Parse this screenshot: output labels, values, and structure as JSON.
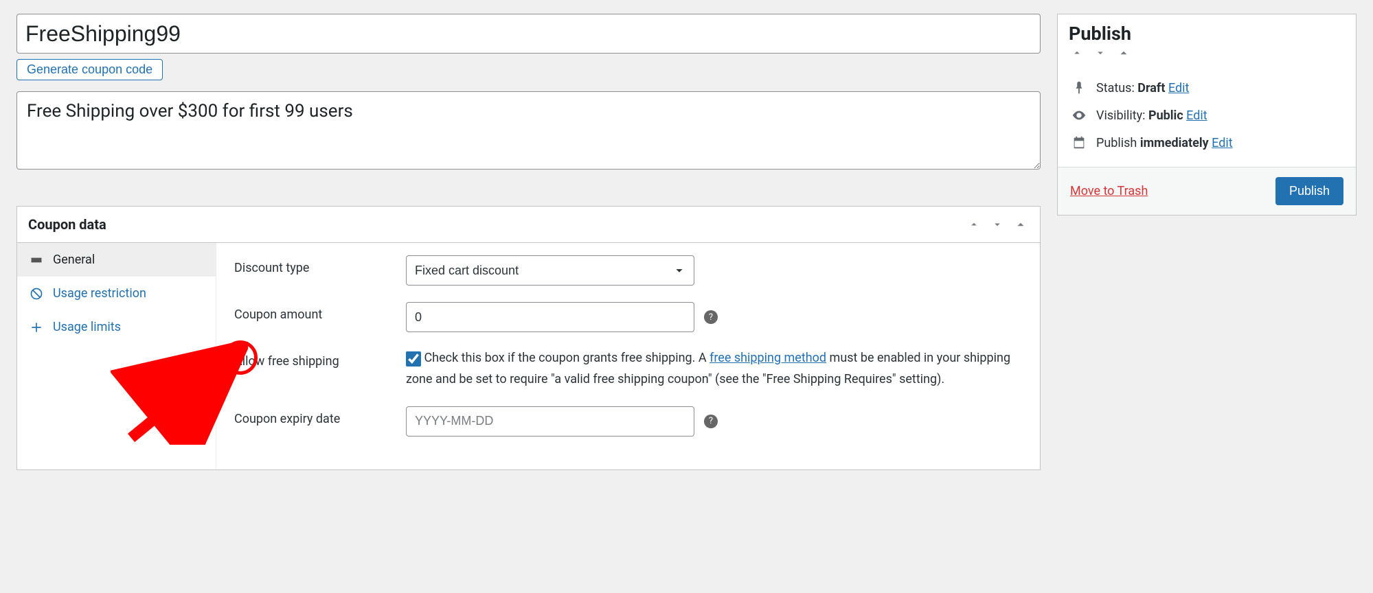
{
  "coupon": {
    "code": "FreeShipping99",
    "generate_label": "Generate coupon code",
    "description": "Free Shipping over $300 for first 99 users"
  },
  "panel": {
    "title": "Coupon data",
    "tabs": [
      {
        "label": "General"
      },
      {
        "label": "Usage restriction"
      },
      {
        "label": "Usage limits"
      }
    ],
    "fields": {
      "discount_type_label": "Discount type",
      "discount_type_value": "Fixed cart discount",
      "coupon_amount_label": "Coupon amount",
      "coupon_amount_value": "0",
      "allow_free_shipping_label": "Allow free shipping",
      "allow_free_shipping_help_pre": "Check this box if the coupon grants free shipping. A ",
      "allow_free_shipping_link": "free shipping method",
      "allow_free_shipping_help_post": " must be enabled in your shipping zone and be set to require \"a valid free shipping coupon\" (see the \"Free Shipping Requires\" setting).",
      "expiry_date_label": "Coupon expiry date",
      "expiry_date_placeholder": "YYYY-MM-DD"
    }
  },
  "publish": {
    "title": "Publish",
    "status_label": "Status:",
    "status_value": "Draft",
    "visibility_label": "Visibility:",
    "visibility_value": "Public",
    "publish_label": "Publish",
    "publish_value": "immediately",
    "edit_label": "Edit",
    "trash_label": "Move to Trash",
    "publish_button": "Publish"
  }
}
